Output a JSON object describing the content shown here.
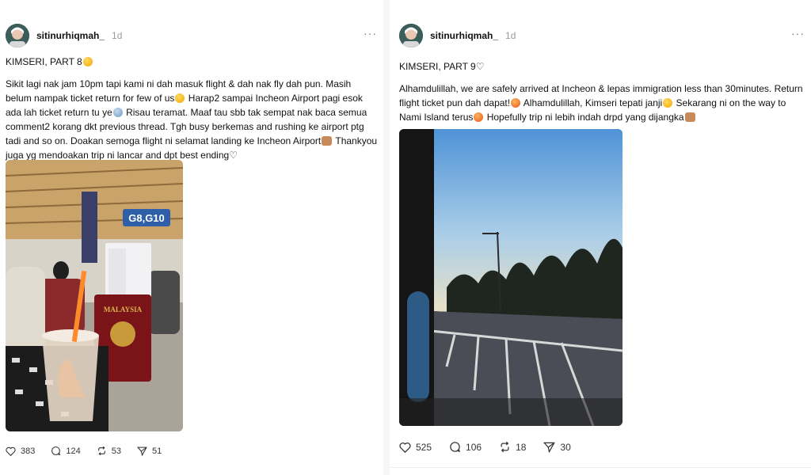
{
  "posts": [
    {
      "username": "sitinurhiqmah_",
      "time": "1d",
      "more": "···",
      "title": "KIMSERI, PART 8",
      "paragraphs": [
        "Sikit lagi nak jam 10pm tapi kami ni dah masuk flight & dah nak fly dah pun. Masih belum nampak ticket return for few of us",
        " Harap2 sampai Incheon Airport pagi esok ada lah ticket return tu ye",
        " Risau teramat. Maaf tau sbb tak sempat nak baca semua comment2 korang dkt previous thread. Tgh busy berkemas and rushing ke airport ptg tadi and so on. Doakan semoga flight ni selamat landing ke Incheon Airport",
        " Thankyou juga yg mendoakan trip ni lancar and dpt best ending"
      ],
      "photo_sign": "G8,G10",
      "passport_text": "MALAYSIA",
      "stats": {
        "likes": "383",
        "comments": "124",
        "reposts": "53",
        "shares": "51"
      }
    },
    {
      "username": "sitinurhiqmah_",
      "time": "1d",
      "more": "···",
      "title": "KIMSERI, PART 9",
      "paragraphs": [
        "Alhamdulillah, we are safely arrived at Incheon & lepas immigration less than 30minutes. Return flight ticket pun dah dapat!",
        " Alhamdulillah, Kimseri tepati janji",
        " Sekarang ni on the way to Nami Island terus",
        " Hopefully trip ni lebih indah drpd yang dijangka"
      ],
      "stats": {
        "likes": "525",
        "comments": "106",
        "reposts": "18",
        "shares": "30"
      }
    }
  ],
  "icons": {
    "like": "heart-icon",
    "comment": "comment-bubble-icon",
    "repost": "repost-icon",
    "share": "send-icon",
    "more": "more-dots-icon"
  },
  "colors": {
    "text": "#111111",
    "muted": "#9a9a9a",
    "background": "#ffffff"
  }
}
